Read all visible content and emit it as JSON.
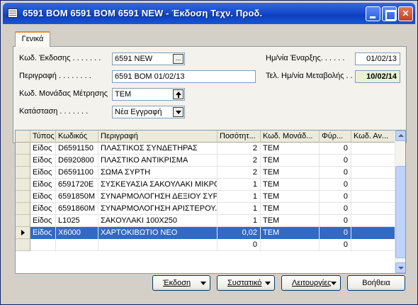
{
  "window": {
    "title": "6591 BOM 6591 BOM 6591 NEW - Έκδοση Τεχν. Προδ."
  },
  "tab": {
    "label": "Γενικά"
  },
  "general": {
    "version_code_label": "Κωδ. Έκδοσης . . . . . . .",
    "version_code_value": "6591 NEW",
    "description_label": "Περιγραφή . . . . . . . .",
    "description_value": "6591 BOM 01/02/13",
    "uom_label": "Κωδ. Μονάδας Μέτρησης",
    "uom_value": "ΤΕΜ",
    "status_label": "Κατάσταση . . . . . . .",
    "status_value": "Νέα Εγγραφή",
    "start_date_label": "Ημ/νία Έναρξης. . . . . .",
    "start_date_value": "01/02/13",
    "last_modified_label": "Τελ. Ημ/νία Μεταβολής . .",
    "last_modified_value": "10/02/14",
    "ellipsis_button": "..."
  },
  "grid": {
    "columns": [
      "Τύπος",
      "Κωδικός",
      "Περιγραφή",
      "Ποσότητ...",
      "Κωδ. Μονάδ...",
      "Φύρ...",
      "Κωδ. Αν..."
    ],
    "rows": [
      {
        "type": "Είδος",
        "code": "D6591150",
        "description": "ΠΛΑΣΤΙΚΟΣ ΣΥΝΔΕΤΗΡΑΣ",
        "qty": "2",
        "uom": "ΤΕΜ",
        "scrap": "0",
        "alt": ""
      },
      {
        "type": "Είδος",
        "code": "D6920800",
        "description": "ΠΛΑΣΤΙΚΟ ΑΝΤΙΚΡΙΣΜΑ",
        "qty": "2",
        "uom": "ΤΕΜ",
        "scrap": "0",
        "alt": ""
      },
      {
        "type": "Είδος",
        "code": "D6591100",
        "description": "ΣΩΜΑ ΣΥΡΤΗ",
        "qty": "2",
        "uom": "ΤΕΜ",
        "scrap": "0",
        "alt": ""
      },
      {
        "type": "Είδος",
        "code": "6591720E",
        "description": "ΣΥΣΚΕΥΑΣΙΑ ΣΑΚΟΥΛΑΚΙ ΜΙΚΡΟ",
        "qty": "1",
        "uom": "ΤΕΜ",
        "scrap": "0",
        "alt": ""
      },
      {
        "type": "Είδος",
        "code": "6591850M",
        "description": "ΣΥΝΑΡΜΟΛΟΓΗΣΗ ΔΕΞΙΟΥ ΣΥΡΤΗ",
        "qty": "1",
        "uom": "ΤΕΜ",
        "scrap": "0",
        "alt": ""
      },
      {
        "type": "Είδος",
        "code": "6591860M",
        "description": "ΣΥΝΑΡΜΟΛΟΓΗΣΗ ΑΡΙΣΤΕΡΟΥ...",
        "qty": "1",
        "uom": "ΤΕΜ",
        "scrap": "0",
        "alt": ""
      },
      {
        "type": "Είδος",
        "code": "L1025",
        "description": "ΣΑΚΟΥΛΑΚΙ 100X250",
        "qty": "1",
        "uom": "ΤΕΜ",
        "scrap": "0",
        "alt": ""
      },
      {
        "type": "Είδος",
        "code": "X6000",
        "description": "ΧΑΡΤΟΚΙΒΩΤΙΟ ΝΕΟ",
        "qty": "0,02",
        "uom": "ΤΕΜ",
        "scrap": "0",
        "alt": ""
      },
      {
        "type": "",
        "code": "",
        "description": "",
        "qty": "0",
        "uom": "",
        "scrap": "0",
        "alt": ""
      }
    ],
    "selected_row": 7
  },
  "buttons": {
    "version": "Έκδοση",
    "component": "Συστατικό",
    "functions": "Λειτουργίες",
    "help": "Βοήθεια"
  }
}
